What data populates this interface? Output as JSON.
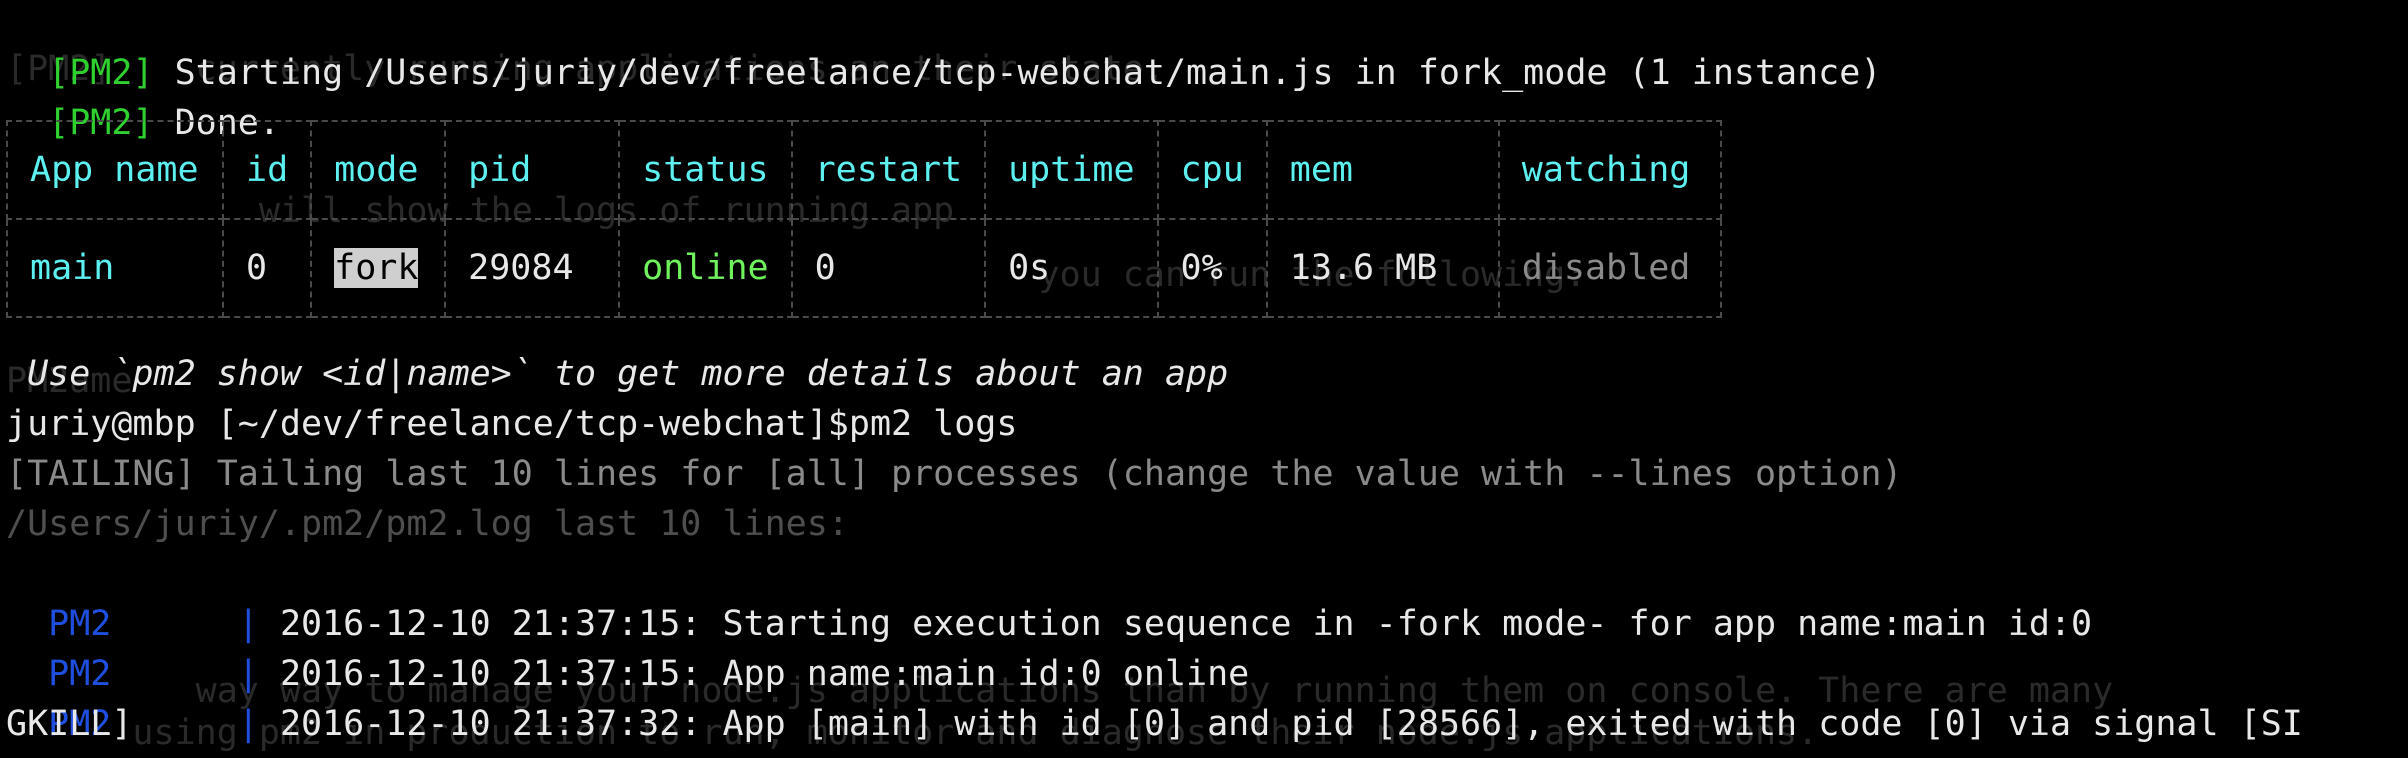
{
  "terminal": {
    "lines": {
      "l1_tag": "[PM2]",
      "l1_text": " Starting /Users/juriy/dev/freelance/tcp-webchat/main.js in fork_mode (1 instance)",
      "l2_tag": "[PM2]",
      "l2_text": " Done.",
      "hint": " Use `pm2 show <id|name>` to get more details about an app",
      "prompt": "juriy@mbp [~/dev/freelance/tcp-webchat]$pm2 logs",
      "tailing": "[TAILING] Tailing last 10 lines for [all] processes (change the value with --lines option)",
      "logfile": "/Users/juriy/.pm2/pm2.log last 10 lines:",
      "log1_src": "PM2",
      "log1_sep": "      | ",
      "log1_msg": "2016-12-10 21:37:15: Starting execution sequence in -fork mode- for app name:main id:0",
      "log2_src": "PM2",
      "log2_sep": "      | ",
      "log2_msg": "2016-12-10 21:37:15: App name:main id:0 online",
      "log3_src": "PM2",
      "log3_sep": "      | ",
      "log3_msg": "2016-12-10 21:37:32: App [main] with id [0] and pid [28566], exited with code [0] via signal [SI",
      "log3_wrap": "GKILL]"
    },
    "ghost": {
      "g1": "[PM2]    currently running applications an their state.",
      "g2": "            will show the logs of running app",
      "g3": "                                                 you can run the following:",
      "g4": "PM2ame",
      "g5": "         way way to manage your node.js applications than by running them on console. There are many",
      "g6": "      using pm2 in production to run, monitor and diagnose their node.js applications."
    },
    "table": {
      "headers": [
        "App name",
        "id",
        "mode",
        "pid",
        "status",
        "restart",
        "uptime",
        "cpu",
        "mem",
        "watching"
      ],
      "row": {
        "app_name": "main",
        "id": "0",
        "mode": "fork",
        "pid": "29084",
        "status": "online",
        "restart": "0",
        "uptime": "0s",
        "cpu": "0%",
        "mem": "13.6 MB",
        "watching": "disabled"
      }
    }
  },
  "colors": {
    "background": "#000000",
    "tag_green": "#2fd12f",
    "header_cyan": "#5cf0f0",
    "status_online": "#6ff25c",
    "log_source_blue": "#1f4fe0",
    "muted_grey": "#8a8a8a"
  }
}
